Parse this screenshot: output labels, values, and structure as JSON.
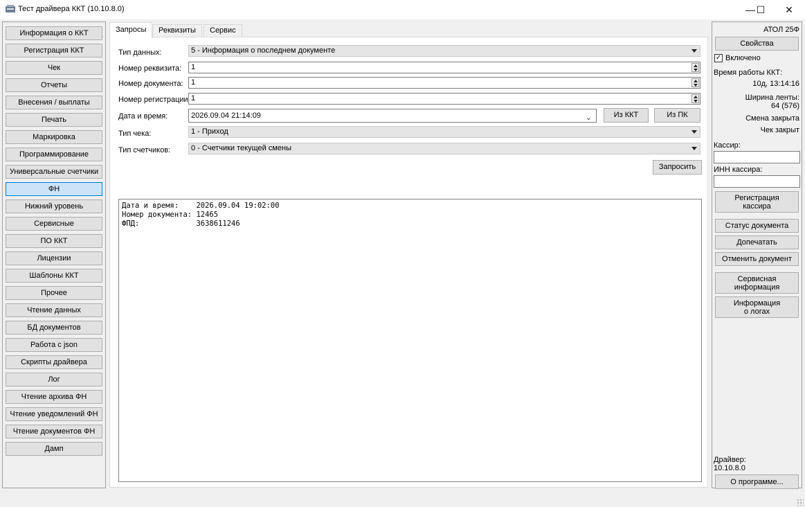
{
  "window": {
    "title": "Тест драйвера ККТ (10.10.8.0)",
    "min_glyph": "—",
    "max_glyph": "☐",
    "close_glyph": "✕"
  },
  "nav": {
    "items": [
      {
        "label": "Информация о ККТ"
      },
      {
        "label": "Регистрация ККТ"
      },
      {
        "label": "Чек"
      },
      {
        "label": "Отчеты"
      },
      {
        "label": "Внесения / выплаты"
      },
      {
        "label": "Печать"
      },
      {
        "label": "Маркировка"
      },
      {
        "label": "Программирование"
      },
      {
        "label": "Универсальные счетчики"
      },
      {
        "label": "ФН",
        "active": true
      },
      {
        "label": "Нижний уровень"
      },
      {
        "label": "Сервисные"
      },
      {
        "label": "ПО ККТ"
      },
      {
        "label": "Лицензии"
      },
      {
        "label": "Шаблоны ККТ"
      },
      {
        "label": "Прочее"
      },
      {
        "label": "Чтение данных"
      },
      {
        "label": "БД документов"
      },
      {
        "label": "Работа с json"
      },
      {
        "label": "Скрипты драйвера"
      },
      {
        "label": "Лог"
      },
      {
        "label": "Чтение архива ФН"
      },
      {
        "label": "Чтение уведомлений ФН"
      },
      {
        "label": "Чтение документов ФН"
      },
      {
        "label": "Дамп"
      }
    ]
  },
  "tabs": [
    {
      "label": "Запросы",
      "active": true
    },
    {
      "label": "Реквизиты"
    },
    {
      "label": "Сервис"
    }
  ],
  "form": {
    "data_type_label": "Тип данных:",
    "data_type_value": "5 - Информация о последнем документе",
    "req_num_label": "Номер реквизита:",
    "req_num_value": "1",
    "doc_num_label": "Номер документа:",
    "doc_num_value": "1",
    "reg_num_label": "Номер регистрации:",
    "reg_num_value": "1",
    "datetime_label": "Дата и время:",
    "datetime_value": "2026.09.04 21:14:09",
    "from_kkt_label": "Из ККТ",
    "from_pc_label": "Из ПК",
    "receipt_type_label": "Тип чека:",
    "receipt_type_value": "1 - Приход",
    "counters_type_label": "Тип счетчиков:",
    "counters_type_value": "0 - Счетчики текущей смены",
    "request_label": "Запросить"
  },
  "output": {
    "lines": [
      "Дата и время:    2026.09.04 19:02:00",
      "Номер документа: 12465",
      "ФПД:             3638611246"
    ]
  },
  "right": {
    "model": "АТОЛ 25Ф",
    "properties_label": "Свойства",
    "enabled_label": "Включено",
    "enabled_check": "✓",
    "uptime_label": "Время работы ККТ:",
    "uptime_value": "10д, 13:14:16",
    "tape_width_label": "Ширина ленты:",
    "tape_width_value": "64 (576)",
    "shift_status": "Смена закрыта",
    "receipt_status": "Чек закрыт",
    "cashier_label": "Кассир:",
    "cashier_value": "",
    "cashier_inn_label": "ИНН кассира:",
    "cashier_inn_value": "",
    "register_cashier_label": "Регистрация\nкассира",
    "doc_status_label": "Статус документа",
    "reprint_label": "Допечатать",
    "cancel_doc_label": "Отменить документ",
    "service_info_label": "Сервисная\nинформация",
    "logs_info_label": "Информация\nо логах",
    "driver_label": "Драйвер:",
    "driver_version": "10.10.8.0",
    "about_label": "О программе..."
  }
}
